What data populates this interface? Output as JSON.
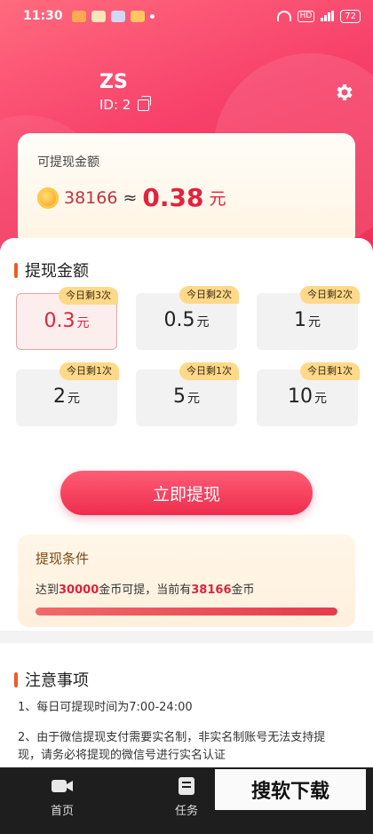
{
  "status_bar": {
    "time": "11:30",
    "battery": "72"
  },
  "user": {
    "name": "ZS",
    "id": "ID: 2"
  },
  "balance": {
    "label": "可提现金额",
    "coins": "38166",
    "approx": "≈",
    "rmb": "0.38",
    "unit": "元"
  },
  "withdraw": {
    "title": "提现金额",
    "options": [
      {
        "amount": "0.3",
        "unit": "元",
        "badge": "今日剩3次",
        "selected": true
      },
      {
        "amount": "0.5",
        "unit": "元",
        "badge": "今日剩2次",
        "selected": false
      },
      {
        "amount": "1",
        "unit": "元",
        "badge": "今日剩2次",
        "selected": false
      },
      {
        "amount": "2",
        "unit": "元",
        "badge": "今日剩1次",
        "selected": false
      },
      {
        "amount": "5",
        "unit": "元",
        "badge": "今日剩1次",
        "selected": false
      },
      {
        "amount": "10",
        "unit": "元",
        "badge": "今日剩1次",
        "selected": false
      }
    ],
    "button": "立即提现"
  },
  "condition": {
    "title": "提现条件",
    "text_prefix": "达到",
    "required": "30000",
    "text_mid": "金币可提，当前有",
    "current": "38166",
    "text_suffix": "金币",
    "progress_fraction": 1.0
  },
  "notes": {
    "title": "注意事项",
    "items": [
      "1、每日可提现时间为7:00-24:00",
      "2、由于微信提现支付需要实名制，非实名制账号无法支持提",
      "现，请务必将提现的微信号进行实名认证"
    ]
  },
  "nav": {
    "home": "首页",
    "tasks": "任务"
  },
  "watermark": "搜软下载",
  "colors": {
    "accent": "#ee2f55",
    "gold": "#ffd98a",
    "brand_orange": "#f05a28"
  }
}
